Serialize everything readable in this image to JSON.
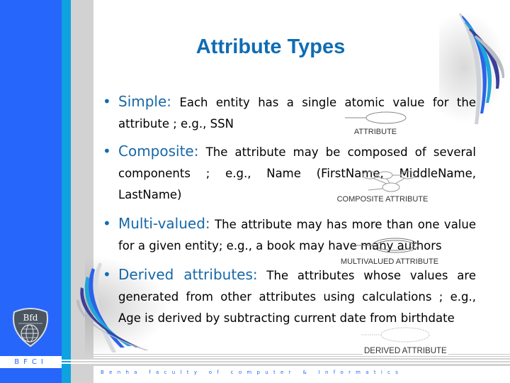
{
  "slide": {
    "title": "Attribute Types",
    "bullets": [
      {
        "term": "Simple:",
        "text": "Each entity has a single atomic value for the attribute ; e.g., SSN"
      },
      {
        "term": "Composite:",
        "text": "The attribute may be composed of several components ; e.g., Name (FirstName, MiddleName, LastName)"
      },
      {
        "term": "Multi-valued:",
        "text": "The attribute may has more than one value for a given entity; e.g., a book may have many authors"
      },
      {
        "term": "Derived attributes:",
        "text": "The attributes whose values are generated from other attributes using calculations ; e.g., Age is derived by subtracting current date from birthdate"
      }
    ],
    "diagrams": [
      {
        "caption": "ATTRIBUTE",
        "icon": "attribute-ellipse-icon"
      },
      {
        "caption": "COMPOSITE ATTRIBUTE",
        "icon": "composite-attribute-icon"
      },
      {
        "caption": "MULTIVALUED ATTRIBUTE",
        "icon": "multivalued-attribute-icon"
      },
      {
        "caption": "DERIVED ATTRIBUTE",
        "icon": "derived-attribute-icon"
      }
    ]
  },
  "branding": {
    "sidebar_label": "BFCI",
    "footer_text": "Benha faculty of computer & Informatics",
    "logo_icon": "faculty-globe-logo",
    "colors": {
      "sidebar_blue": "#2766fb",
      "sidebar_cyan": "#0fa2e0",
      "title_blue": "#0f6cb4",
      "term_blue": "#1768a8"
    }
  }
}
